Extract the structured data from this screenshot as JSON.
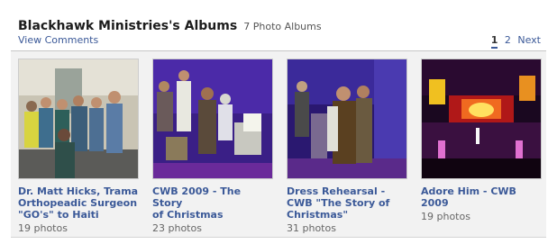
{
  "header": {
    "title": "Blackhawk Ministries's Albums",
    "count": "7 Photo Albums",
    "view_comments": "View Comments"
  },
  "pager": {
    "page1": "1",
    "page2": "2",
    "next": "Next"
  },
  "albums": [
    {
      "title": "Dr. Matt Hicks, Trama\nOrthopeadic Surgeon\n\"GO's\" to Haiti",
      "count": "19 photos"
    },
    {
      "title": "CWB 2009 - The Story\nof Christmas",
      "count": "23 photos"
    },
    {
      "title": "Dress Rehearsal -\nCWB \"The Story of\nChristmas\"",
      "count": "31 photos"
    },
    {
      "title": "Adore Him - CWB\n2009",
      "count": "19 photos"
    }
  ],
  "colors": {
    "link": "#3b5998",
    "panel_bg": "#f2f2f2"
  }
}
